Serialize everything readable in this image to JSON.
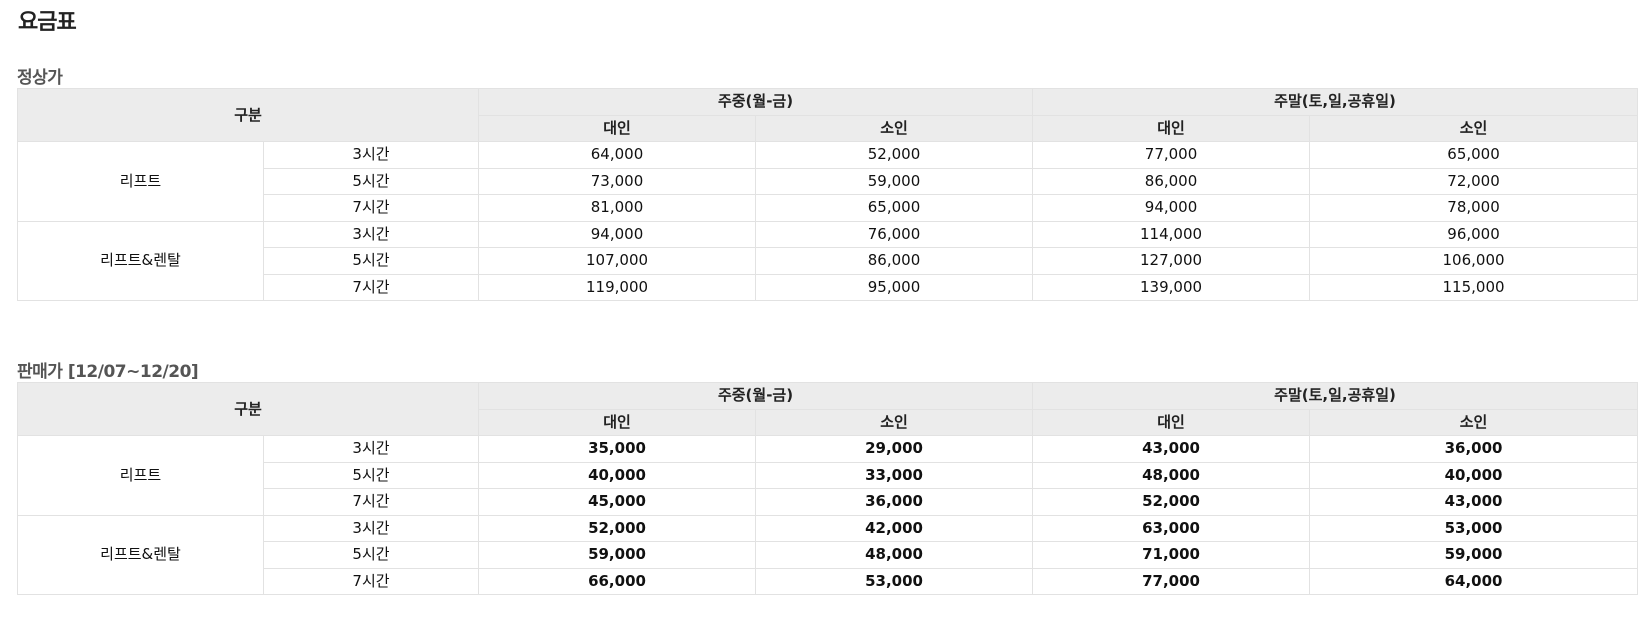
{
  "page_title": "요금표",
  "sections": [
    {
      "title": "정상가",
      "header": {
        "category": "구분",
        "weekday": "주중(월-금)",
        "weekend": "주말(토,일,공휴일)",
        "adult": "대인",
        "child": "소인"
      },
      "groups": [
        {
          "label": "리프트",
          "rows": [
            {
              "duration": "3시간",
              "values": [
                "64,000",
                "52,000",
                "77,000",
                "65,000"
              ]
            },
            {
              "duration": "5시간",
              "values": [
                "73,000",
                "59,000",
                "86,000",
                "72,000"
              ]
            },
            {
              "duration": "7시간",
              "values": [
                "81,000",
                "65,000",
                "94,000",
                "78,000"
              ]
            }
          ]
        },
        {
          "label": "리프트&렌탈",
          "rows": [
            {
              "duration": "3시간",
              "values": [
                "94,000",
                "76,000",
                "114,000",
                "96,000"
              ]
            },
            {
              "duration": "5시간",
              "values": [
                "107,000",
                "86,000",
                "127,000",
                "106,000"
              ]
            },
            {
              "duration": "7시간",
              "values": [
                "119,000",
                "95,000",
                "139,000",
                "115,000"
              ]
            }
          ]
        }
      ]
    },
    {
      "title": "판매가 [12/07~12/20]",
      "header": {
        "category": "구분",
        "weekday": "주중(월-금)",
        "weekend": "주말(토,일,공휴일)",
        "adult": "대인",
        "child": "소인"
      },
      "groups": [
        {
          "label": "리프트",
          "rows": [
            {
              "duration": "3시간",
              "values": [
                "35,000",
                "29,000",
                "43,000",
                "36,000"
              ]
            },
            {
              "duration": "5시간",
              "values": [
                "40,000",
                "33,000",
                "48,000",
                "40,000"
              ]
            },
            {
              "duration": "7시간",
              "values": [
                "45,000",
                "36,000",
                "52,000",
                "43,000"
              ]
            }
          ]
        },
        {
          "label": "리프트&렌탈",
          "rows": [
            {
              "duration": "3시간",
              "values": [
                "52,000",
                "42,000",
                "63,000",
                "53,000"
              ]
            },
            {
              "duration": "5시간",
              "values": [
                "59,000",
                "48,000",
                "71,000",
                "59,000"
              ]
            },
            {
              "duration": "7시간",
              "values": [
                "66,000",
                "53,000",
                "77,000",
                "64,000"
              ]
            }
          ]
        }
      ]
    }
  ],
  "colors": {
    "header_bg": "#ececec",
    "border": "#e2e2e2",
    "sale_lift": "#e8432a",
    "sale_lift_rental": "#ff7a1f"
  }
}
